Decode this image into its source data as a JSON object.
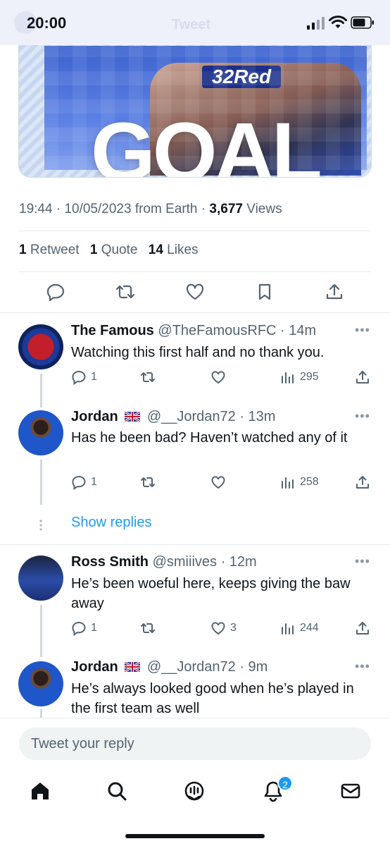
{
  "status_bar": {
    "time": "20:00",
    "ghost_title": "Tweet"
  },
  "media": {
    "sponsor_text": "32Red",
    "overlay_text": "GOAL"
  },
  "tweet": {
    "time": "19:44",
    "date": "10/05/2023",
    "source": "from Earth",
    "views_count": "3,677",
    "views_label": "Views",
    "retweets_count": "1",
    "retweets_label": "Retweet",
    "quotes_count": "1",
    "quotes_label": "Quote",
    "likes_count": "14",
    "likes_label": "Likes"
  },
  "replies": [
    {
      "name": "The Famous",
      "handle": "@TheFamousRFC",
      "time": "14m",
      "text": "Watching this first half and no thank you.",
      "replies": "1",
      "retweets": "",
      "likes": "",
      "views": "295"
    },
    {
      "name": "Jordan",
      "handle": "@__Jordan72",
      "time": "13m",
      "text": "Has he been bad? Haven’t watched any of it",
      "replies": "1",
      "retweets": "",
      "likes": "",
      "views": "258"
    },
    {
      "name": "Ross Smith",
      "handle": "@smiiives",
      "time": "12m",
      "text": "He’s been woeful here, keeps giving the baw away",
      "replies": "1",
      "retweets": "",
      "likes": "3",
      "views": "244"
    },
    {
      "name": "Jordan",
      "handle": "@__Jordan72",
      "time": "9m",
      "text": "He’s always looked good when he’s played in the first team as well",
      "replies": "",
      "retweets": "",
      "likes": "",
      "views": ""
    }
  ],
  "show_replies_label": "Show replies",
  "compose": {
    "placeholder": "Tweet your reply"
  },
  "notifications_badge": "2",
  "colors": {
    "accent": "#1d9bf0",
    "text": "#0f1419",
    "muted": "#536471"
  }
}
